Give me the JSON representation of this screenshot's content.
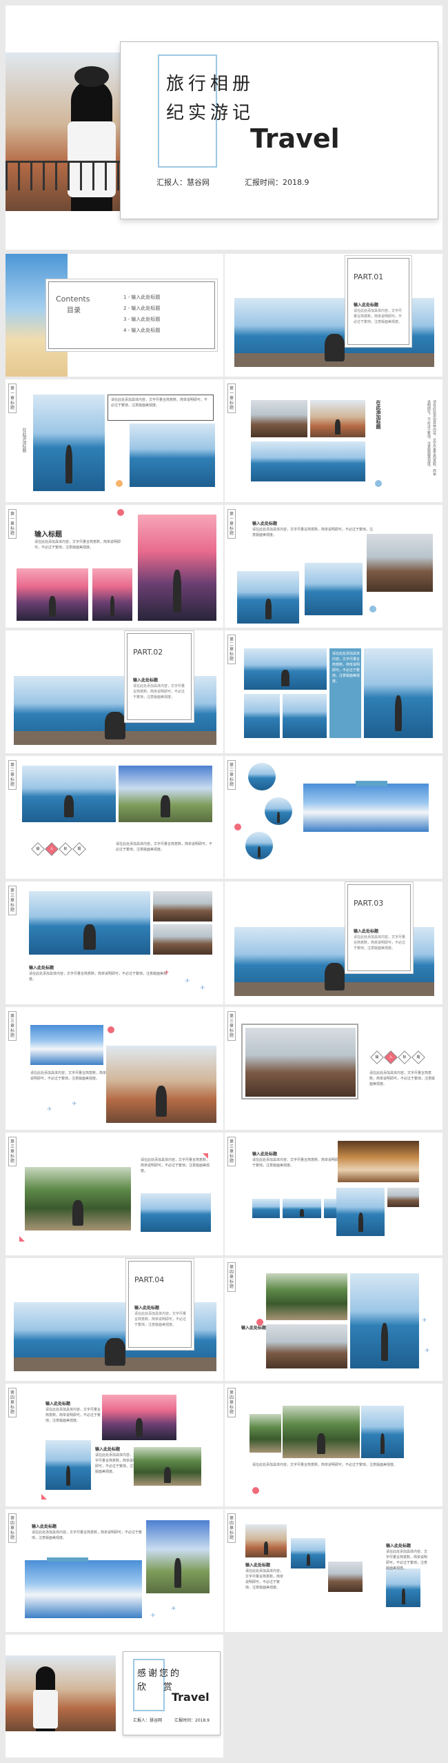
{
  "cover": {
    "title_line1": "旅行相册",
    "title_line2": "纪实游记",
    "travel": "Travel",
    "reporter": "汇报人：慧谷网",
    "date": "汇报时间：2018.9"
  },
  "contents": {
    "title_en": "Contents",
    "title_cn": "目录",
    "items": [
      "1 - 输入此处标题",
      "2 - 输入此处标题",
      "3 - 输入此处标题",
      "4 - 输入此处标题"
    ]
  },
  "parts": [
    "PART.01",
    "PART.02",
    "PART.03",
    "PART.04"
  ],
  "part_subtitle": "输入此处标题",
  "section_label": "第一章标题",
  "section_labels": [
    "第一章标题",
    "第二章标题",
    "第三章标题",
    "第四章标题"
  ],
  "heading": "输入标题",
  "small_heading": "输入此处标题",
  "vertical_title": "在此添加标题",
  "body_text": "请在此处添加具体内容，文字尽量言简意赅，简单说明即可，不必过于繁琐，注意版面美观度。",
  "diamonds": [
    "输",
    "入",
    "标",
    "题"
  ],
  "thanks": {
    "line1": "感谢您的",
    "line2": "欣      赏",
    "travel": "Travel",
    "reporter": "汇报人：慧谷网",
    "date": "汇报时间：2018.9"
  },
  "colors": {
    "accent": "#5ea3c9",
    "pink": "#f06b7a",
    "frame": "#bcd7e8"
  }
}
